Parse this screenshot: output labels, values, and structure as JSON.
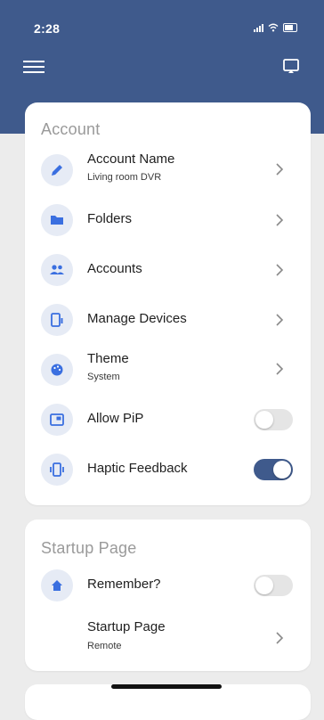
{
  "status_bar": {
    "time": "2:28"
  },
  "colors": {
    "brand": "#3f5a8c",
    "icon_blue": "#3a6fe0",
    "toggle_off": "#e5e5e5"
  },
  "account_section": {
    "title": "Account",
    "items": [
      {
        "label": "Account Name",
        "sublabel": "Living room DVR",
        "icon": "pencil-icon",
        "control": "chevron"
      },
      {
        "label": "Folders",
        "icon": "folder-icon",
        "control": "chevron"
      },
      {
        "label": "Accounts",
        "icon": "people-icon",
        "control": "chevron"
      },
      {
        "label": "Manage Devices",
        "icon": "devices-icon",
        "control": "chevron"
      },
      {
        "label": "Theme",
        "sublabel": "System",
        "icon": "palette-icon",
        "control": "chevron"
      },
      {
        "label": "Allow PiP",
        "icon": "pip-icon",
        "control": "toggle",
        "enabled": false
      },
      {
        "label": "Haptic Feedback",
        "icon": "vibration-icon",
        "control": "toggle",
        "enabled": true
      }
    ]
  },
  "startup_section": {
    "title": "Startup Page",
    "items": [
      {
        "label": "Remember?",
        "icon": "home-icon",
        "control": "toggle",
        "enabled": false
      },
      {
        "label": "Startup Page",
        "sublabel": "Remote",
        "control": "chevron"
      }
    ]
  }
}
